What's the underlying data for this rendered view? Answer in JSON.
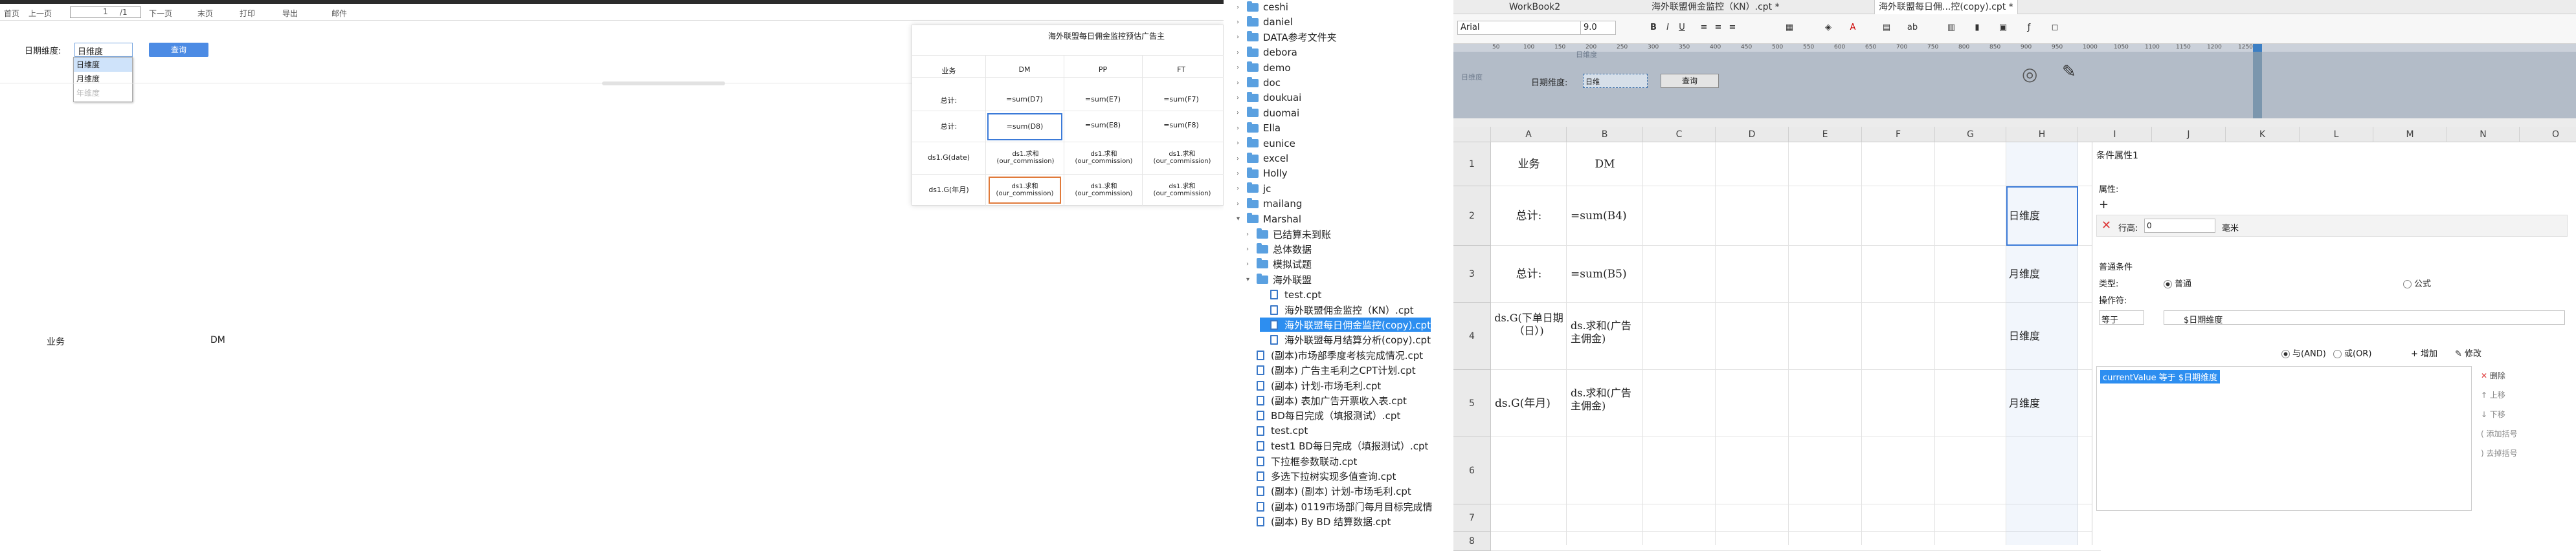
{
  "viewer": {
    "toolbar": {
      "first": "首页",
      "prev": "上一页",
      "page": "1",
      "total": "/1",
      "next": "下一页",
      "last": "末页",
      "print": "打印",
      "export": "导出",
      "mail": "邮件"
    },
    "filter": {
      "label": "日期维度:",
      "value": "日维度",
      "options": [
        "日维度",
        "月维度",
        "年维度"
      ],
      "query": "查询"
    },
    "report": {
      "col1": "业务",
      "col2": "DM"
    },
    "preview": {
      "title": "海外联盟每日佣金监控预估广告主",
      "headers": [
        "业务",
        "DM",
        "PP",
        "FT"
      ],
      "rows": [
        {
          "label": "总计:",
          "cells": [
            "=sum(D7)",
            "=sum(E7)",
            "=sum(F7)"
          ]
        },
        {
          "label": "总计:",
          "cells": [
            "=sum(D8)",
            "=sum(E8)",
            "=sum(F8)"
          ]
        },
        {
          "label": "ds1.G(date)",
          "cells": [
            "ds1.求和(our_commission)",
            "ds1.求和(our_commission)",
            "ds1.求和(our_commission)"
          ]
        },
        {
          "label": "ds1.G(年月)",
          "cells": [
            "ds1.求和(our_commission)",
            "ds1.求和(our_commission)",
            "ds1.求和(our_commission)"
          ]
        }
      ]
    }
  },
  "tree": {
    "items": [
      {
        "type": "folder",
        "label": "ceshi",
        "indent": 0
      },
      {
        "type": "folder",
        "label": "daniel",
        "indent": 0
      },
      {
        "type": "folder",
        "label": "DATA参考文件夹",
        "indent": 0
      },
      {
        "type": "folder",
        "label": "debora",
        "indent": 0
      },
      {
        "type": "folder",
        "label": "demo",
        "indent": 0
      },
      {
        "type": "folder",
        "label": "doc",
        "indent": 0
      },
      {
        "type": "folder",
        "label": "doukuai",
        "indent": 0
      },
      {
        "type": "folder",
        "label": "duomai",
        "indent": 0
      },
      {
        "type": "folder",
        "label": "Ella",
        "indent": 0
      },
      {
        "type": "folder",
        "label": "eunice",
        "indent": 0
      },
      {
        "type": "folder",
        "label": "excel",
        "indent": 0
      },
      {
        "type": "folder",
        "label": "Holly",
        "indent": 0
      },
      {
        "type": "folder",
        "label": "jc",
        "indent": 0
      },
      {
        "type": "folder",
        "label": "mailang",
        "indent": 0
      },
      {
        "type": "folder",
        "label": "Marshal",
        "indent": 0,
        "open": true
      },
      {
        "type": "folder",
        "label": "已结算未到账",
        "indent": 1
      },
      {
        "type": "folder",
        "label": "总体数据",
        "indent": 1
      },
      {
        "type": "folder",
        "label": "模拟试题",
        "indent": 1
      },
      {
        "type": "folder",
        "label": "海外联盟",
        "indent": 1,
        "open": true
      },
      {
        "type": "file",
        "label": "test.cpt",
        "indent": 2
      },
      {
        "type": "file",
        "label": "海外联盟佣金监控（KN）.cpt",
        "indent": 2
      },
      {
        "type": "file",
        "label": "海外联盟每日佣金监控(copy).cpt",
        "indent": 2,
        "selected": true
      },
      {
        "type": "file",
        "label": "海外联盟每月结算分析(copy).cpt",
        "indent": 2
      },
      {
        "type": "file",
        "label": "(副本)市场部季度考核完成情况.cpt",
        "indent": 1
      },
      {
        "type": "file",
        "label": "(副本) 广告主毛利之CPT计划.cpt",
        "indent": 1
      },
      {
        "type": "file",
        "label": "(副本) 计划-市场毛利.cpt",
        "indent": 1
      },
      {
        "type": "file",
        "label": "(副本) 表加广告开票收入表.cpt",
        "indent": 1
      },
      {
        "type": "file",
        "label": "BD每日完成（填报测试）.cpt",
        "indent": 1
      },
      {
        "type": "file",
        "label": "test.cpt",
        "indent": 1
      },
      {
        "type": "file",
        "label": "test1 BD每日完成（填报测试）.cpt",
        "indent": 1
      },
      {
        "type": "file",
        "label": "下拉框参数联动.cpt",
        "indent": 1
      },
      {
        "type": "file",
        "label": "多选下拉树实现多值查询.cpt",
        "indent": 1
      },
      {
        "type": "file",
        "label": "(副本) (副本) 计划-市场毛利.cpt",
        "indent": 1
      },
      {
        "type": "file",
        "label": "(副本) 0119市场部门每月目标完成情",
        "indent": 1
      },
      {
        "type": "file",
        "label": "(副本) By BD 结算数据.cpt",
        "indent": 1
      }
    ]
  },
  "designer": {
    "tabs": [
      "WorkBook2",
      "海外联盟佣金监控（KN）.cpt *",
      "海外联盟每日佣...控(copy).cpt *"
    ],
    "font": "Arial",
    "size": "9.0",
    "param": {
      "label": "日期维度:",
      "combo": "日维",
      "btn": "查询",
      "ruler_label": "日维度"
    },
    "columns": [
      "A",
      "B",
      "C",
      "D",
      "E",
      "F",
      "G",
      "H",
      "I",
      "J",
      "K",
      "L",
      "M",
      "N",
      "O"
    ],
    "rows": [
      "1",
      "2",
      "3",
      "4",
      "5",
      "6",
      "7",
      "8"
    ],
    "cells": {
      "a1": "业务",
      "b1": "DM",
      "a2": "总计:",
      "b2": "=sum(B4)",
      "a3": "总计:",
      "b3": "=sum(B5)",
      "a4": "ds.G(下单日期（日）)",
      "b4": "ds.求和(广告主佣金)",
      "a5": "ds.G(年月)",
      "b5": "ds.求和(广告主佣金)",
      "h2": "日维度",
      "h3": "月维度",
      "h4": "日维度",
      "h5": "月维度"
    },
    "ruler": [
      "50",
      "100",
      "150",
      "200",
      "250",
      "300",
      "350",
      "400",
      "450",
      "500",
      "550",
      "600",
      "650",
      "700",
      "750",
      "800",
      "850",
      "900",
      "950",
      "1000",
      "1050",
      "1100",
      "1150",
      "1200",
      "1250"
    ],
    "props": {
      "title": "条件属性1",
      "attr": "属性:",
      "rowheight_label": "行高:",
      "rowheight_value": "0",
      "unit": "毫米",
      "section": "普通条件",
      "type_label": "类型:",
      "type_normal": "普通",
      "type_formula": "公式",
      "op_label": "操作符:",
      "op_value": "等于",
      "param_value": "$日期维度",
      "and": "与(AND)",
      "or": "或(OR)",
      "add": "增加",
      "edit": "修改",
      "cond": "currentValue 等于 $日期维度",
      "btns": [
        "删除",
        "上移",
        "下移",
        "添加括号",
        "去掉括号"
      ]
    }
  }
}
